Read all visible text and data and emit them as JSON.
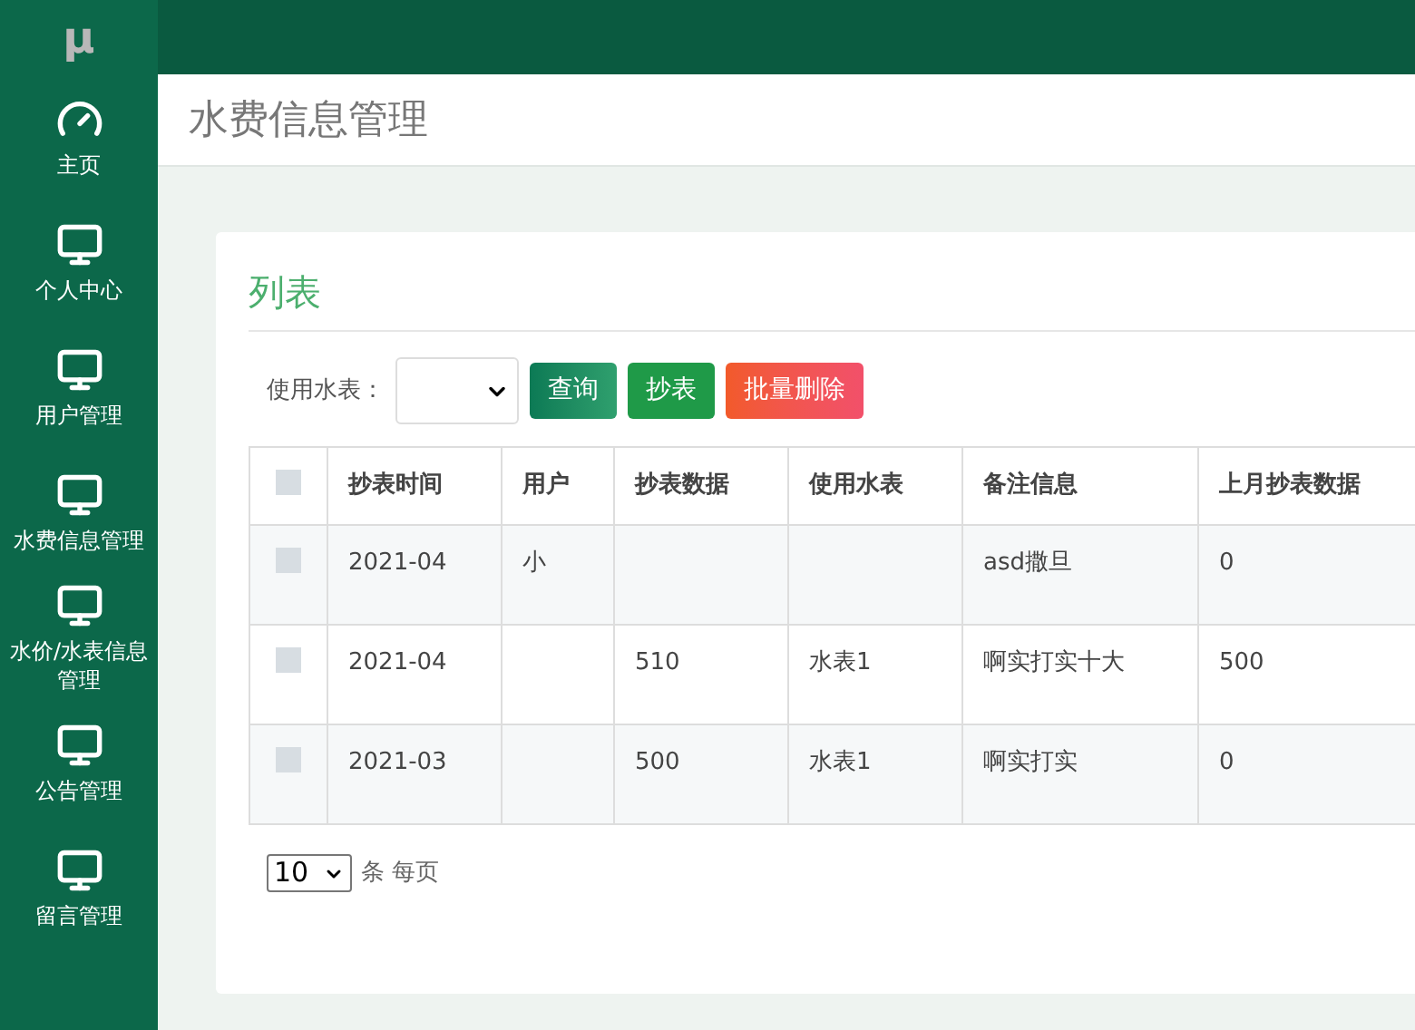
{
  "logo": "μ",
  "sidebar": {
    "items": [
      {
        "label": "主页",
        "kind": "home"
      },
      {
        "label": "个人中心",
        "kind": "module"
      },
      {
        "label": "用户管理",
        "kind": "module"
      },
      {
        "label": "水费信息管理",
        "kind": "module"
      },
      {
        "label": "水价/水表信息管理",
        "kind": "module"
      },
      {
        "label": "公告管理",
        "kind": "module"
      },
      {
        "label": "留言管理",
        "kind": "module"
      }
    ]
  },
  "page_title": "水费信息管理",
  "card": {
    "title": "列表",
    "filter": {
      "label": "使用水表："
    },
    "buttons": [
      {
        "label": "查询",
        "kind": "query"
      },
      {
        "label": "抄表",
        "kind": "read"
      },
      {
        "label": "批量删除",
        "kind": "delete"
      }
    ],
    "table": {
      "all_checked": false,
      "columns": [
        "抄表时间",
        "用户",
        "抄表数据",
        "使用水表",
        "备注信息",
        "上月抄表数据"
      ],
      "rows": [
        {
          "checked": false,
          "cells": [
            "2021-04",
            "小",
            "",
            "",
            "asd撒旦",
            "0"
          ]
        },
        {
          "checked": false,
          "cells": [
            "2021-04",
            "",
            "510",
            "水表1",
            "啊实打实十大",
            "500"
          ]
        },
        {
          "checked": false,
          "cells": [
            "2021-03",
            "",
            "500",
            "水表1",
            "啊实打实",
            "0"
          ]
        }
      ]
    },
    "pagination": {
      "page_size": "10",
      "label": "条 每页"
    }
  }
}
